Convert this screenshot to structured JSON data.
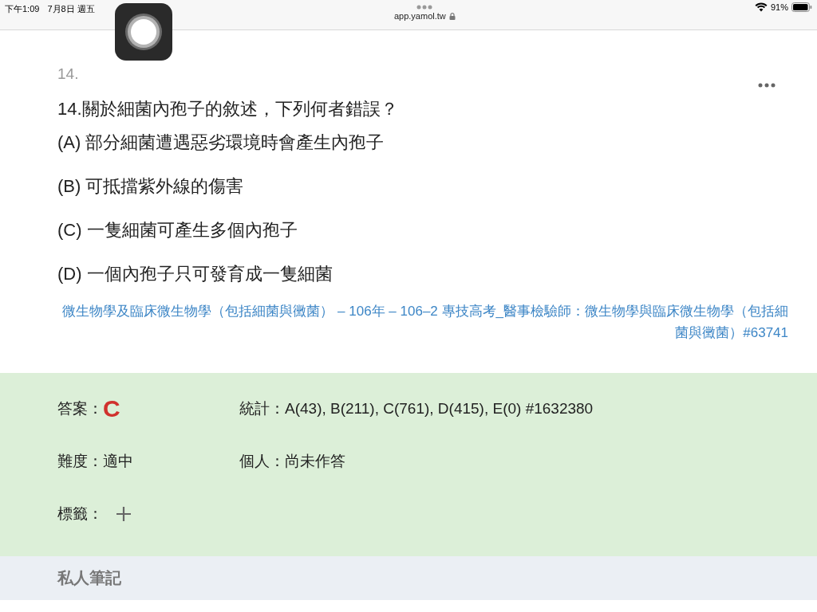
{
  "status_bar": {
    "time": "下午1:09",
    "date": "7月8日 週五",
    "url": "app.yamol.tw",
    "battery": "91%"
  },
  "question": {
    "number": "14.",
    "text": "14.關於細菌內孢子的敘述，下列何者錯誤？",
    "options": [
      {
        "label": "(A) 部分細菌遭遇惡劣環境時會產生內孢子"
      },
      {
        "label": "(B) 可抵擋紫外線的傷害"
      },
      {
        "label": "(C) 一隻細菌可產生多個內孢子"
      },
      {
        "label": "(D) 一個內孢子只可發育成一隻細菌"
      }
    ],
    "source": "微生物學及臨床微生物學（包括細菌與黴菌） – 106年 – 106–2 專技高考_醫事檢驗師：微生物學與臨床微生物學（包括細菌與黴菌）#63741"
  },
  "answer_panel": {
    "answer_label": "答案：",
    "answer": "C",
    "stats": "統計：A(43), B(211), C(761), D(415), E(0) #1632380",
    "difficulty": "難度：適中",
    "personal": "個人：尚未作答",
    "tags_label": "標籤："
  },
  "notes": {
    "title": "私人筆記"
  }
}
